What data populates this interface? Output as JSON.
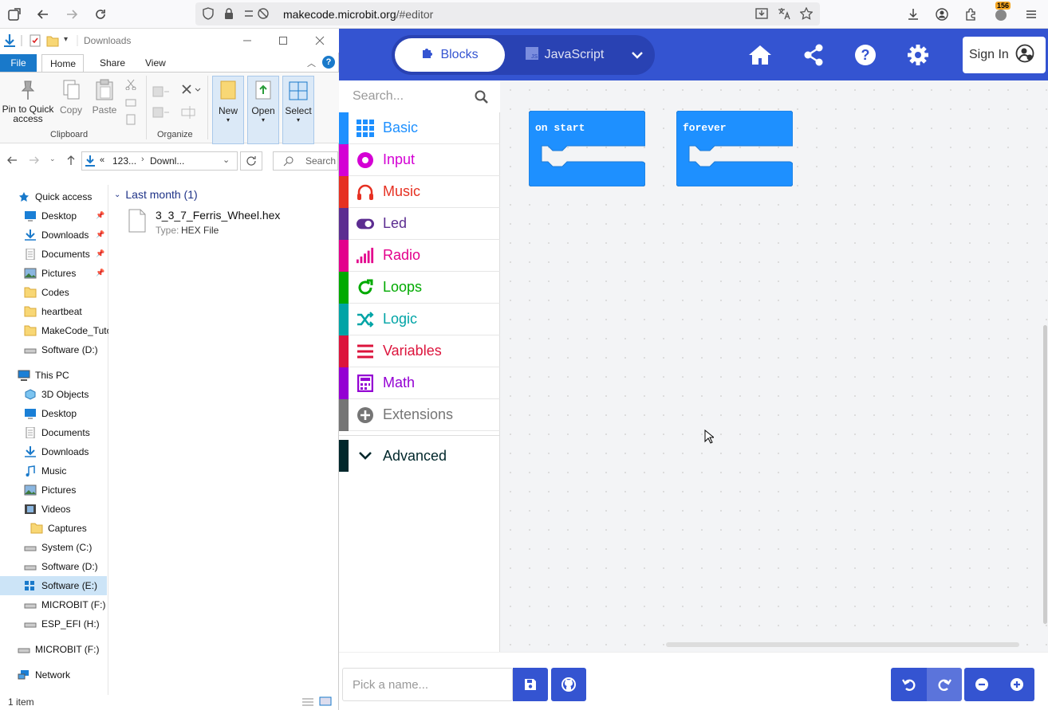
{
  "browser": {
    "url_domain": "makecode.microbit.org",
    "url_path": "/#editor",
    "extension_badge": "156"
  },
  "explorer": {
    "title": "Downloads",
    "tabs": [
      "File",
      "Home",
      "Share",
      "View"
    ],
    "ribbon": {
      "pin_label": "Pin to Quick access",
      "copy_label": "Copy",
      "paste_label": "Paste",
      "new_label": "New",
      "open_label": "Open",
      "select_label": "Select",
      "group_clipboard": "Clipboard",
      "group_organize": "Organize"
    },
    "address": {
      "seg1": "123...",
      "seg2": "Downl...",
      "search_placeholder": "Search D"
    },
    "nav": {
      "quick_access": "Quick access",
      "quick_items": [
        "Desktop",
        "Downloads",
        "Documents",
        "Pictures",
        "Codes",
        "heartbeat",
        "MakeCode_Tuto",
        "Software (D:)"
      ],
      "this_pc": "This PC",
      "pc_items": [
        "3D Objects",
        "Desktop",
        "Documents",
        "Downloads",
        "Music",
        "Pictures",
        "Videos",
        "Captures",
        "System (C:)",
        "Software (D:)",
        "Software (E:)",
        "MICROBIT (F:)",
        "ESP_EFI (H:)"
      ],
      "microbit": "MICROBIT (F:)",
      "network": "Network"
    },
    "group_header": "Last month (1)",
    "file": {
      "name": "3_3_7_Ferris_Wheel.hex",
      "type_label": "Type:",
      "type_value": "HEX File"
    },
    "status": "1 item"
  },
  "makecode": {
    "tab_blocks": "Blocks",
    "tab_javascript": "JavaScript",
    "sign_in": "Sign In",
    "search_placeholder": "Search...",
    "categories": [
      {
        "label": "Basic",
        "color": "#1e90ff"
      },
      {
        "label": "Input",
        "color": "#d400d4"
      },
      {
        "label": "Music",
        "color": "#e63022"
      },
      {
        "label": "Led",
        "color": "#5c2d91"
      },
      {
        "label": "Radio",
        "color": "#e3008c"
      },
      {
        "label": "Loops",
        "color": "#00aa00"
      },
      {
        "label": "Logic",
        "color": "#00a4a6"
      },
      {
        "label": "Variables",
        "color": "#dc143c"
      },
      {
        "label": "Math",
        "color": "#9400d3"
      },
      {
        "label": "Extensions",
        "color": "#757575"
      }
    ],
    "advanced": "Advanced",
    "advanced_color": "#00272b",
    "blocks": {
      "on_start": "on start",
      "forever": "forever",
      "color": "#1e90ff"
    },
    "project_name_placeholder": "Pick a name...",
    "header_color": "#3454d1"
  }
}
